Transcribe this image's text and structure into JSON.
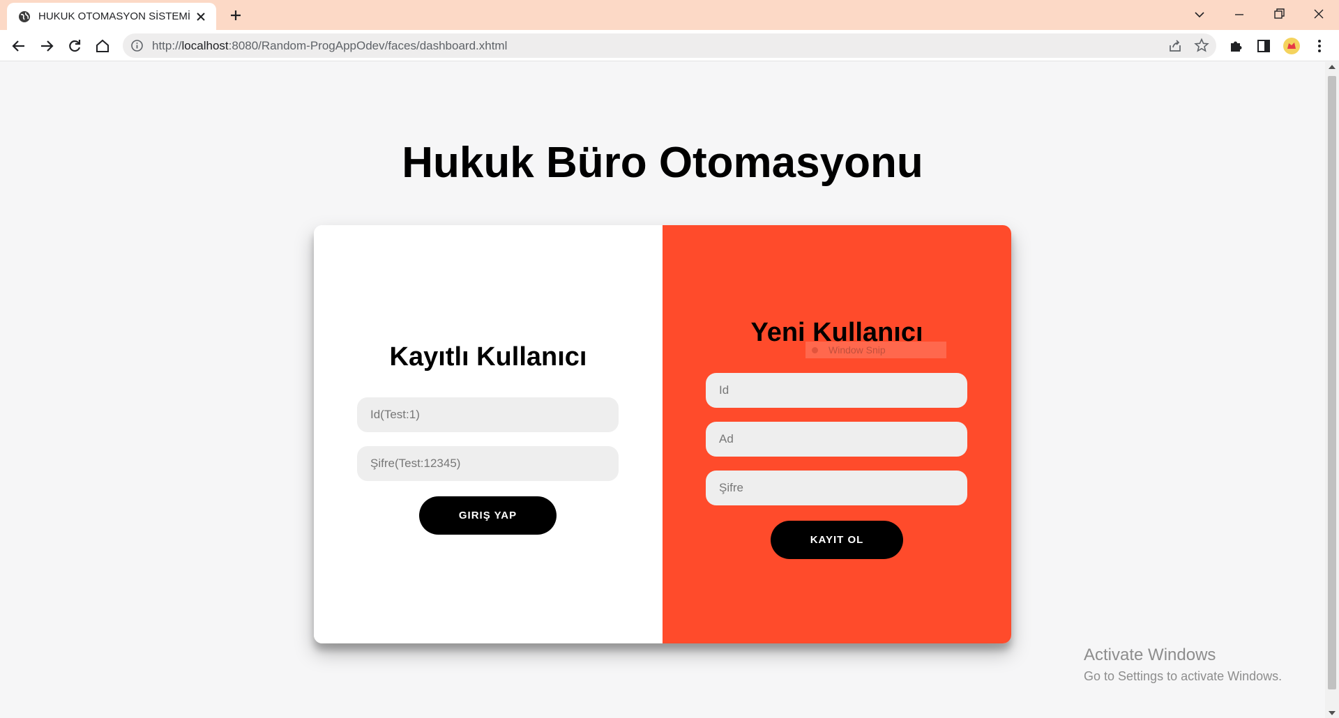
{
  "browser": {
    "tab_title": "HUKUK OTOMASYON SİSTEMİ",
    "url_scheme": "http://",
    "url_host": "localhost",
    "url_path": ":8080/Random-ProgAppOdev/faces/dashboard.xhtml"
  },
  "page": {
    "title": "Hukuk Büro Otomasyonu"
  },
  "login": {
    "heading": "Kayıtlı Kullanıcı",
    "id_placeholder": "Id(Test:1)",
    "password_placeholder": "Şifre(Test:12345)",
    "submit_label": "GIRIŞ YAP"
  },
  "register": {
    "heading": "Yeni Kullanıcı",
    "id_placeholder": "Id",
    "name_placeholder": "Ad",
    "password_placeholder": "Şifre",
    "submit_label": "KAYIT OL",
    "panel_color": "#ff4b2b"
  },
  "overlay": {
    "snip_label": "Window Snip"
  },
  "watermark": {
    "title": "Activate Windows",
    "subtitle": "Go to Settings to activate Windows."
  }
}
